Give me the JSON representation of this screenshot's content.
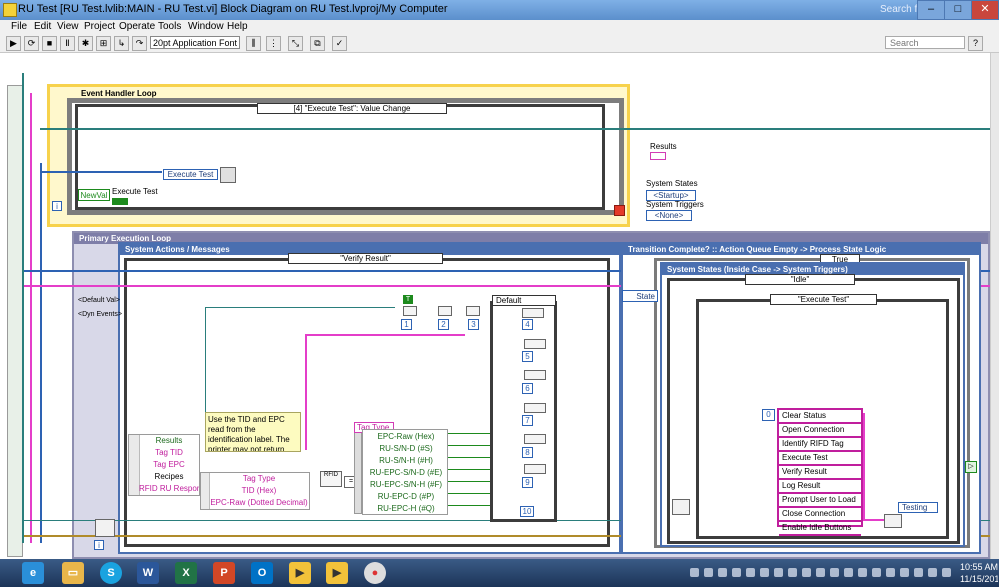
{
  "window": {
    "title": "RU Test [RU Test.lvlib:MAIN - RU Test.vi] Block Diagram on RU Test.lvproj/My Computer",
    "search_hint": "Search for Business"
  },
  "menu": [
    "File",
    "Edit",
    "View",
    "Project",
    "Operate",
    "Tools",
    "Window",
    "Help"
  ],
  "toolbar": {
    "font": "20pt Application Font",
    "search_placeholder": "Search"
  },
  "event_loop": {
    "label": "Event Handler Loop",
    "event_case": "[4] \"Execute Test\": Value Change",
    "newval": "NewVal",
    "execute_test_label": "Execute Test",
    "execute_test_enum": "Execute Test",
    "iteration": "i"
  },
  "right_labels": {
    "results": "Results",
    "system_states": "System States",
    "startup": "<Startup>",
    "system_triggers": "System Triggers",
    "none": "<None>"
  },
  "primary": {
    "label": "Primary Execution Loop",
    "sys_actions": "System Actions / Messages",
    "verify_case": "\"Verify Result\"",
    "default_val": "<Default Val>",
    "dyn_events": "<Dyn Events>",
    "cluster_top": [
      "Results",
      "Tag TID",
      "Tag EPC",
      "Recipes",
      "RFID RU Respon"
    ],
    "cluster_mid": [
      "Tag Type",
      "TID (Hex)",
      "EPC-Raw (Dotted Decimal)"
    ],
    "note": "Use the TID and EPC read from the identification label. The printer may not return",
    "tag_type": "Tag Type",
    "tag_items": [
      "EPC-Raw (Hex)",
      "RU-S/N-D (#S)",
      "RU-S/N-H (#H)",
      "RU-EPC-S/N-D (#E)",
      "RU-EPC-S/N-H (#F)",
      "RU-EPC-D (#P)",
      "RU-EPC-H (#Q)"
    ],
    "bool_const": "T",
    "num_consts": [
      "1",
      "2",
      "3"
    ],
    "default_case": "Default",
    "inner_nums": [
      "4",
      "5",
      "6",
      "7",
      "8",
      "9",
      "10"
    ],
    "iter": "i"
  },
  "transition": {
    "label": "Transition Complete? :: Action Queue Empty -> Process State Logic",
    "true_case": "True",
    "state_label": "State",
    "sys_states": "System States  (Inside Case -> System Triggers)",
    "idle_case": "\"Idle\"",
    "execute_case": "\"Execute Test\"",
    "array_index": "0",
    "array_items": [
      "Clear Status",
      "Open Connection",
      "Identify RIFD Tag",
      "Execute Test",
      "Verify Result",
      "Log Result",
      "Prompt User to Load",
      "Close Connection",
      "Enable Idle Buttons"
    ],
    "testing": "Testing"
  },
  "taskbar": {
    "clock_time": "10:55 AM",
    "clock_date": "11/15/2017",
    "apps": [
      "IE",
      "Folder",
      "Skype",
      "Word",
      "Excel",
      "PowerPoint",
      "Outlook",
      "LabVIEW",
      "LabVIEW",
      "Chrome"
    ]
  }
}
